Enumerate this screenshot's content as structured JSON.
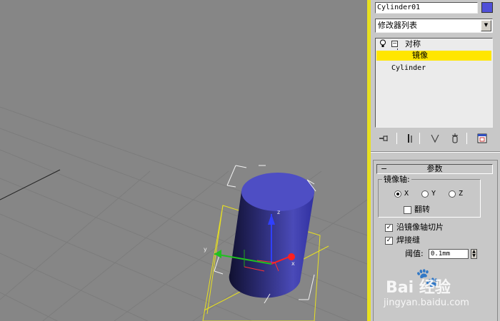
{
  "viewport": {},
  "command_panel": {
    "object_name": "Cylinder01",
    "object_color": "#5050d8",
    "modifier_list": {
      "label": "修改器列表",
      "arrow": "▼"
    },
    "modifier_stack": {
      "items": [
        {
          "label": "对称",
          "expanded_marker": "−",
          "visibility_icon": "bulb-icon"
        },
        {
          "label": "镜像",
          "selected": true
        },
        {
          "label": "Cylinder"
        }
      ],
      "highlight_color": "#ffe600"
    },
    "stack_toolbar": {
      "icons": [
        "pin-stack-icon",
        "show-end-result-icon",
        "make-unique-icon",
        "remove-modifier-icon",
        "configure-sets-icon"
      ]
    },
    "parameters": {
      "rollout_marker": "−",
      "rollout_title": "参数",
      "mirror_axis": {
        "group_label": "镜像轴:",
        "options": [
          "X",
          "Y",
          "Z"
        ],
        "selected": "X",
        "flip_label": "翻转",
        "flip_checked": false
      },
      "slice_along_mirror": {
        "label": "沿镜像轴切片",
        "checked": true
      },
      "weld_seam": {
        "label": "焊接缝",
        "checked": true
      },
      "threshold": {
        "label": "阈值:",
        "value": "0.1mm"
      }
    }
  },
  "watermark": {
    "logo": "Bai 经验",
    "url": "jingyan.baidu.com"
  }
}
